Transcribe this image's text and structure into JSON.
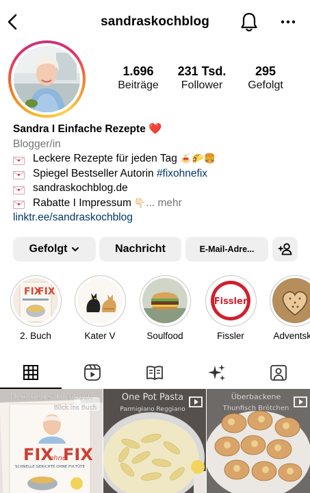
{
  "header": {
    "username": "sandraskochblog"
  },
  "stats": [
    {
      "value": "1.696",
      "label": "Beiträge"
    },
    {
      "value": "231 Tsd.",
      "label": "Follower"
    },
    {
      "value": "295",
      "label": "Gefolgt"
    }
  ],
  "bio": {
    "name": "Sandra I Einfache Rezepte ❤️",
    "category": "Blogger/in",
    "lines": [
      {
        "text": "Leckere Rezepte für jeden Tag",
        "emoji": "🍝🌮🍔"
      },
      {
        "text_prefix": "Spiegel Bestseller Autorin ",
        "hashtag": "#fixohnefix"
      },
      {
        "text": "sandraskochblog.de"
      },
      {
        "text": "Rabatte I Impressum",
        "emoji": "👇🏻",
        "more": "... mehr"
      }
    ],
    "link": "linktr.ee/sandraskochblog"
  },
  "actions": {
    "follow": "Gefolgt",
    "message": "Nachricht",
    "email": "E-Mail-Adre..."
  },
  "highlights": [
    {
      "label": "2. Buch"
    },
    {
      "label": "Kater V"
    },
    {
      "label": "Soulfood"
    },
    {
      "label": "Fissler",
      "logo_text": "Fissler"
    },
    {
      "label": "Adventska"
    }
  ],
  "posts": [
    {
      "caption_top": "Mein neues Kochbuch",
      "caption_sub": "Blick ins Buch",
      "book_title_a": "FIX",
      "book_title_b": "FIX",
      "book_small": "ohne",
      "book_sub": "SCHNELLE GERICHTE OHNE FIX-TÜTE"
    },
    {
      "caption_top": "One Pot Pasta",
      "caption_sub": "Parmigiano Reggiano"
    },
    {
      "caption_top": "Überbackene",
      "caption_sub": "Thunfisch Brötchen"
    }
  ],
  "colors": {
    "link": "#00376b",
    "muted": "#737373",
    "button_bg": "#efefef"
  }
}
